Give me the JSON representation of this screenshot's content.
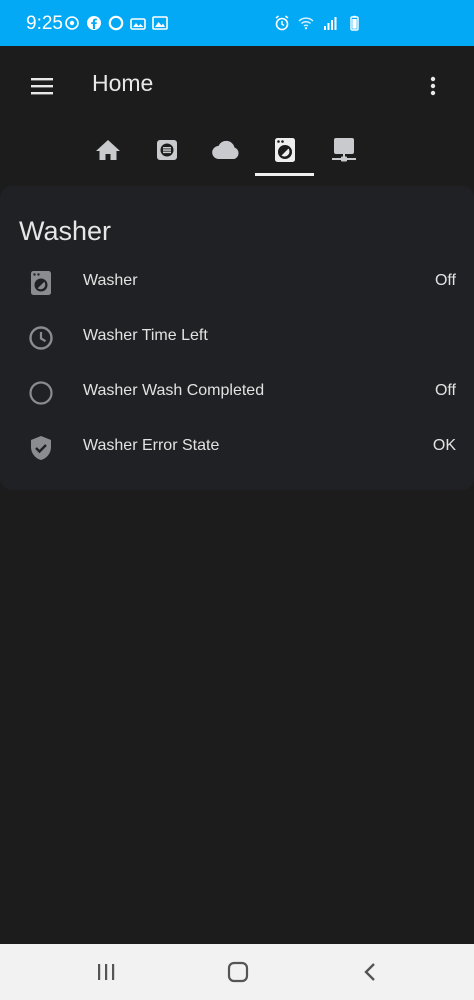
{
  "status_bar": {
    "time": "9:25",
    "left_icons": [
      "sync-icon",
      "facebook-icon",
      "circle-app-icon",
      "gallery-icon",
      "photo-icon"
    ],
    "right_icons": [
      "alarm-icon",
      "wifi-icon",
      "signal-icon",
      "battery-icon"
    ]
  },
  "app_bar": {
    "title": "Home",
    "menu_icon": "menu-icon",
    "overflow_icon": "more-vert-icon"
  },
  "tabs": [
    {
      "icon": "home-icon",
      "active": false
    },
    {
      "icon": "list-icon",
      "active": false
    },
    {
      "icon": "cloud-icon",
      "active": false
    },
    {
      "icon": "washing-machine-icon",
      "active": true
    },
    {
      "icon": "network-icon",
      "active": false
    }
  ],
  "card": {
    "title": "Washer",
    "rows": [
      {
        "icon": "washing-machine-icon",
        "label": "Washer",
        "state": "Off"
      },
      {
        "icon": "clock-icon",
        "label": "Washer Time Left",
        "state": ""
      },
      {
        "icon": "circle-outline-icon",
        "label": "Washer Wash Completed",
        "state": "Off"
      },
      {
        "icon": "shield-check-icon",
        "label": "Washer Error State",
        "state": "OK"
      }
    ]
  },
  "nav_bar": {
    "buttons": [
      "recent-apps-icon",
      "home-button-icon",
      "back-icon"
    ]
  },
  "colors": {
    "status_bar": "#03a9f4",
    "background": "#1c1c1d",
    "card": "#202124",
    "icon_gray": "#8a8c90"
  }
}
